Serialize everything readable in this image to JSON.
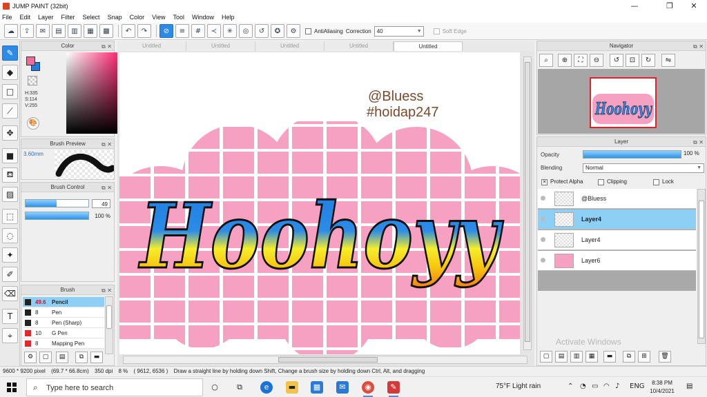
{
  "window": {
    "title": "JUMP PAINT (32bit)",
    "minimize": "—",
    "maximize": "❐",
    "close": "✕"
  },
  "menu": [
    "File",
    "Edit",
    "Layer",
    "Filter",
    "Select",
    "Snap",
    "Color",
    "View",
    "Tool",
    "Window",
    "Help"
  ],
  "toolbar": {
    "antialiasing_label": "AntiAliasing",
    "correction_label": "Correction",
    "correction_value": "40",
    "soft_edge_label": "Soft Edge"
  },
  "color_panel": {
    "title": "Color",
    "h": "H:335",
    "s": "S:114",
    "v": "V:255",
    "fg_color": "#f06a9c",
    "bg_color": "#1f7de0"
  },
  "brush_preview": {
    "title": "Brush Preview",
    "size": "3.60mm"
  },
  "brush_control": {
    "title": "Brush Control",
    "size_value": "49",
    "size_fraction": 0.49,
    "density_value": "100 %",
    "density_fraction": 1.0
  },
  "brush_panel": {
    "title": "Brush",
    "items": [
      {
        "size": "49.6",
        "name": "Pencil",
        "color": "#222222",
        "selected": true
      },
      {
        "size": "8",
        "name": "Pen",
        "color": "#222222",
        "selected": false
      },
      {
        "size": "8",
        "name": "Pen (Sharp)",
        "color": "#222222",
        "selected": false
      },
      {
        "size": "10",
        "name": "G Pen",
        "color": "#e02a2a",
        "selected": false
      },
      {
        "size": "8",
        "name": "Mapping Pen",
        "color": "#e02a2a",
        "selected": false
      }
    ]
  },
  "tabs": [
    {
      "label": "Untitled",
      "active": false
    },
    {
      "label": "Untitled",
      "active": false
    },
    {
      "label": "Untitled",
      "active": false
    },
    {
      "label": "Untitled",
      "active": false
    },
    {
      "label": "Untitled",
      "active": true
    }
  ],
  "canvas": {
    "handle": "@Bluess",
    "tag": "#hoidap247",
    "art_text": "Hoohoyy"
  },
  "navigator": {
    "title": "Navigator"
  },
  "layer_panel": {
    "title": "Layer",
    "opacity_label": "Opacity",
    "opacity_value": "100 %",
    "blending_label": "Blending",
    "blending_value": "Normal",
    "protect_alpha_label": "Protect Alpha",
    "clipping_label": "Clipping",
    "lock_label": "Lock",
    "layers": [
      {
        "name": "@Bluess",
        "selected": false
      },
      {
        "name": "Layer4",
        "selected": true
      },
      {
        "name": "Layer4",
        "selected": false
      },
      {
        "name": "Layer6",
        "selected": false
      }
    ],
    "watermark": "Activate Windows"
  },
  "status": {
    "pixels": "9600 * 9200 pixel",
    "size_cm": "(69.7 * 66.8cm)",
    "dpi": "350 dpi",
    "zoom": "8 %",
    "coords": "( 9612, 6536 )",
    "hint": "Draw a straight line by holding down Shift, Change a brush size by holding down Ctrl, Alt, and dragging"
  },
  "taskbar": {
    "search_placeholder": "Type here to search",
    "weather": "75°F  Light rain",
    "lang": "ENG",
    "time": "8:38 PM",
    "date": "10/4/2021"
  }
}
